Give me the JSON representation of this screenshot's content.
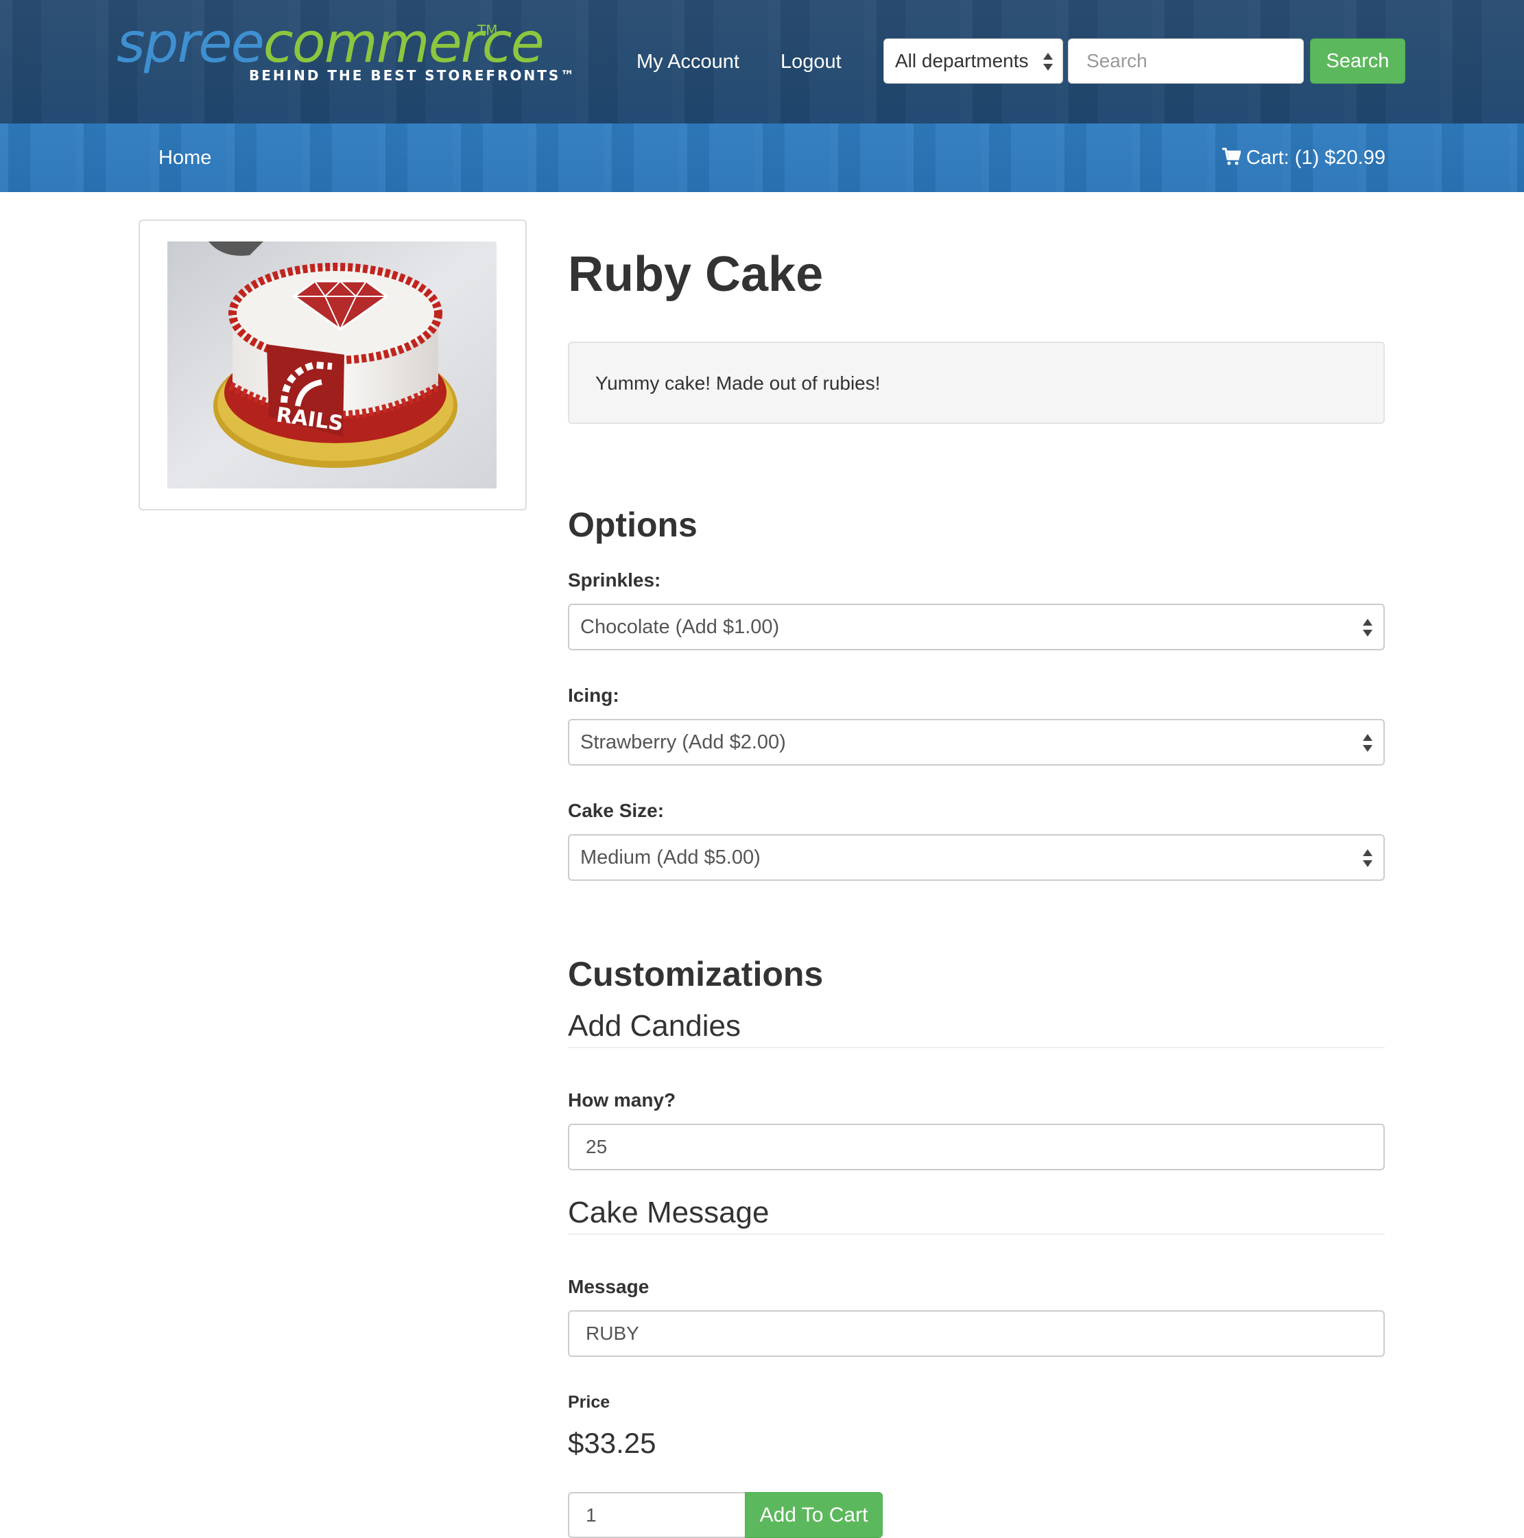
{
  "header": {
    "logo": {
      "part1": "spree",
      "part2": "commerce",
      "tm": "TM",
      "tagline": "BEHIND THE BEST STOREFRONTS™"
    },
    "nav": {
      "my_account": "My Account",
      "logout": "Logout"
    },
    "search": {
      "department": "All departments",
      "placeholder": "Search",
      "button_label": "Search"
    }
  },
  "subnav": {
    "home": "Home",
    "cart": "Cart: (1) $20.99",
    "cart_icon": "shopping-cart-icon"
  },
  "product": {
    "title": "Ruby Cake",
    "description": "Yummy cake! Made out of rubies!",
    "image": {
      "subject": "cake",
      "label": "RAILS"
    }
  },
  "options": {
    "heading": "Options",
    "fields": [
      {
        "label": "Sprinkles:",
        "value": "Chocolate (Add $1.00)"
      },
      {
        "label": "Icing:",
        "value": "Strawberry (Add $2.00)"
      },
      {
        "label": "Cake Size:",
        "value": "Medium (Add $5.00)"
      }
    ]
  },
  "customizations": {
    "heading": "Customizations",
    "candies": {
      "heading": "Add Candies",
      "label": "How many?",
      "value": "25"
    },
    "message": {
      "heading": "Cake Message",
      "label": "Message",
      "value": "RUBY"
    }
  },
  "purchase": {
    "price_label": "Price",
    "price": "$33.25",
    "quantity": "1",
    "add_to_cart": "Add To Cart"
  },
  "colors": {
    "header_bg": "#244a70",
    "subnav_bg": "#2a75b8",
    "logo_blue": "#3f90d1",
    "logo_green": "#8cc63f",
    "success_green": "#5cb85c"
  }
}
